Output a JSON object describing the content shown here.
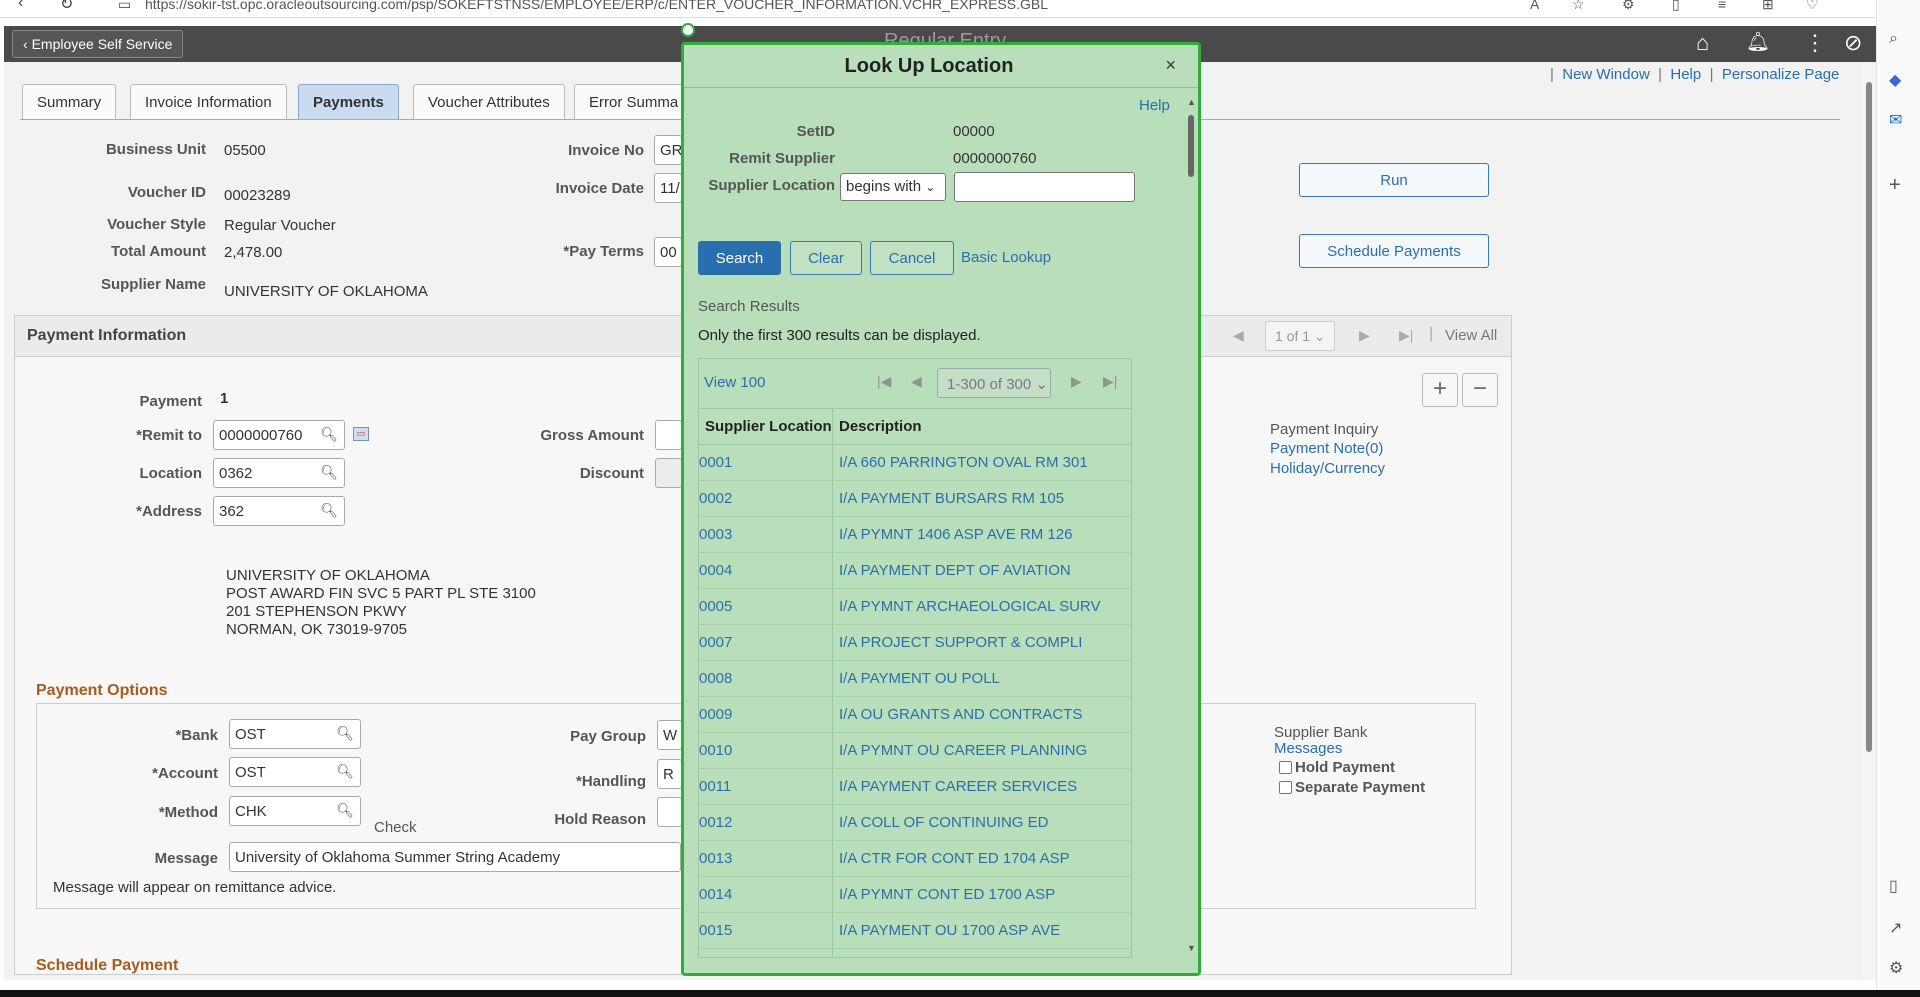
{
  "browser": {
    "url": "https://sokir-tst.opc.oracleoutsourcing.com/psp/SOKEFTSTNSS/EMPLOYEE/ERP/c/ENTER_VOUCHER_INFORMATION.VCHR_EXPRESS.GBL"
  },
  "header": {
    "back_label": "Employee Self Service",
    "page_title": "Regular Entry"
  },
  "toplinks": {
    "new_window": "New Window",
    "help": "Help",
    "personalize": "Personalize Page"
  },
  "tabs": [
    "Summary",
    "Invoice Information",
    "Payments",
    "Voucher Attributes",
    "Error Summa"
  ],
  "voucher": {
    "business_unit_label": "Business Unit",
    "business_unit": "05500",
    "voucher_id_label": "Voucher ID",
    "voucher_id": "00023289",
    "voucher_style_label": "Voucher Style",
    "voucher_style": "Regular Voucher",
    "total_amount_label": "Total Amount",
    "total_amount": "2,478.00",
    "supplier_name_label": "Supplier Name",
    "supplier_name": "UNIVERSITY OF OKLAHOMA",
    "invoice_no_label": "Invoice No",
    "invoice_no": "GR",
    "invoice_date_label": "Invoice Date",
    "invoice_date": "11/",
    "pay_terms_label": "*Pay Terms",
    "pay_terms": "00"
  },
  "actions": {
    "run": "Run",
    "schedule_payments": "Schedule Payments"
  },
  "payment_info": {
    "title": "Payment Information",
    "pager": "1 of 1",
    "view_all": "View All",
    "payment_label": "Payment",
    "payment": "1",
    "remit_to_label": "*Remit to",
    "remit_to": "0000000760",
    "location_label": "Location",
    "location": "0362",
    "address_label": "*Address",
    "address": "362",
    "gross_amount_label": "Gross Amount",
    "discount_label": "Discount",
    "address_lines": [
      "UNIVERSITY OF OKLAHOMA",
      "POST AWARD FIN SVC 5 PART PL STE 3100",
      "201 STEPHENSON PKWY",
      "NORMAN, OK  73019-9705"
    ],
    "payment_inquiry": "Payment Inquiry",
    "payment_note": "Payment Note(0)",
    "holiday_currency": "Holiday/Currency"
  },
  "payment_options": {
    "title": "Payment Options",
    "bank_label": "*Bank",
    "bank": "OST",
    "account_label": "*Account",
    "account": "OST",
    "method_label": "*Method",
    "method": "CHK",
    "method_desc": "Check",
    "pay_group_label": "Pay Group",
    "pay_group": "W",
    "handling_label": "*Handling",
    "handling": "R",
    "hold_reason_label": "Hold Reason",
    "message_label": "Message",
    "message": "University of Oklahoma Summer String Academy",
    "message_note": "Message will appear on remittance advice.",
    "supplier_bank": "Supplier Bank",
    "messages": "Messages",
    "hold_payment": "Hold Payment",
    "separate_payment": "Separate Payment"
  },
  "schedule_payment": {
    "title": "Schedule Payment"
  },
  "modal": {
    "title": "Look Up Location",
    "close": "×",
    "help": "Help",
    "setid_label": "SetID",
    "setid": "00000",
    "remit_supplier_label": "Remit Supplier",
    "remit_supplier": "0000000760",
    "supplier_location_label": "Supplier Location",
    "operator": "begins with",
    "search": "Search",
    "clear": "Clear",
    "cancel": "Cancel",
    "basic_lookup": "Basic Lookup",
    "results_title": "Search Results",
    "results_note": "Only the first 300 results can be displayed.",
    "view_100": "View 100",
    "grid_pager": "1-300 of 300",
    "col_location": "Supplier Location",
    "col_description": "Description",
    "rows": [
      {
        "loc": "0001",
        "desc": "I/A 660 PARRINGTON OVAL RM 301"
      },
      {
        "loc": "0002",
        "desc": "I/A PAYMENT BURSARS RM 105"
      },
      {
        "loc": "0003",
        "desc": "I/A PYMNT 1406 ASP AVE RM 126"
      },
      {
        "loc": "0004",
        "desc": "I/A PAYMENT DEPT OF AVIATION"
      },
      {
        "loc": "0005",
        "desc": "I/A PYMNT ARCHAEOLOGICAL SURV"
      },
      {
        "loc": "0007",
        "desc": "I/A PROJECT SUPPORT & COMPLI"
      },
      {
        "loc": "0008",
        "desc": "I/A PAYMENT OU POLL"
      },
      {
        "loc": "0009",
        "desc": "I/A OU GRANTS AND CONTRACTS"
      },
      {
        "loc": "0010",
        "desc": "I/A PYMNT OU CAREER PLANNING"
      },
      {
        "loc": "0011",
        "desc": "I/A PAYMENT CAREER SERVICES"
      },
      {
        "loc": "0012",
        "desc": "I/A COLL OF CONTINUING ED"
      },
      {
        "loc": "0013",
        "desc": "I/A CTR FOR CONT ED 1704 ASP"
      },
      {
        "loc": "0014",
        "desc": "I/A PYMNT CONT ED 1700 ASP"
      },
      {
        "loc": "0015",
        "desc": "I/A PAYMENT OU 1700 ASP AVE"
      }
    ]
  },
  "colors": {
    "modal_bg": "#b9dfba",
    "modal_border": "#2fae3c",
    "link": "#2a6fad",
    "primary": "#2a6fad",
    "header": "#4a4a4a"
  }
}
